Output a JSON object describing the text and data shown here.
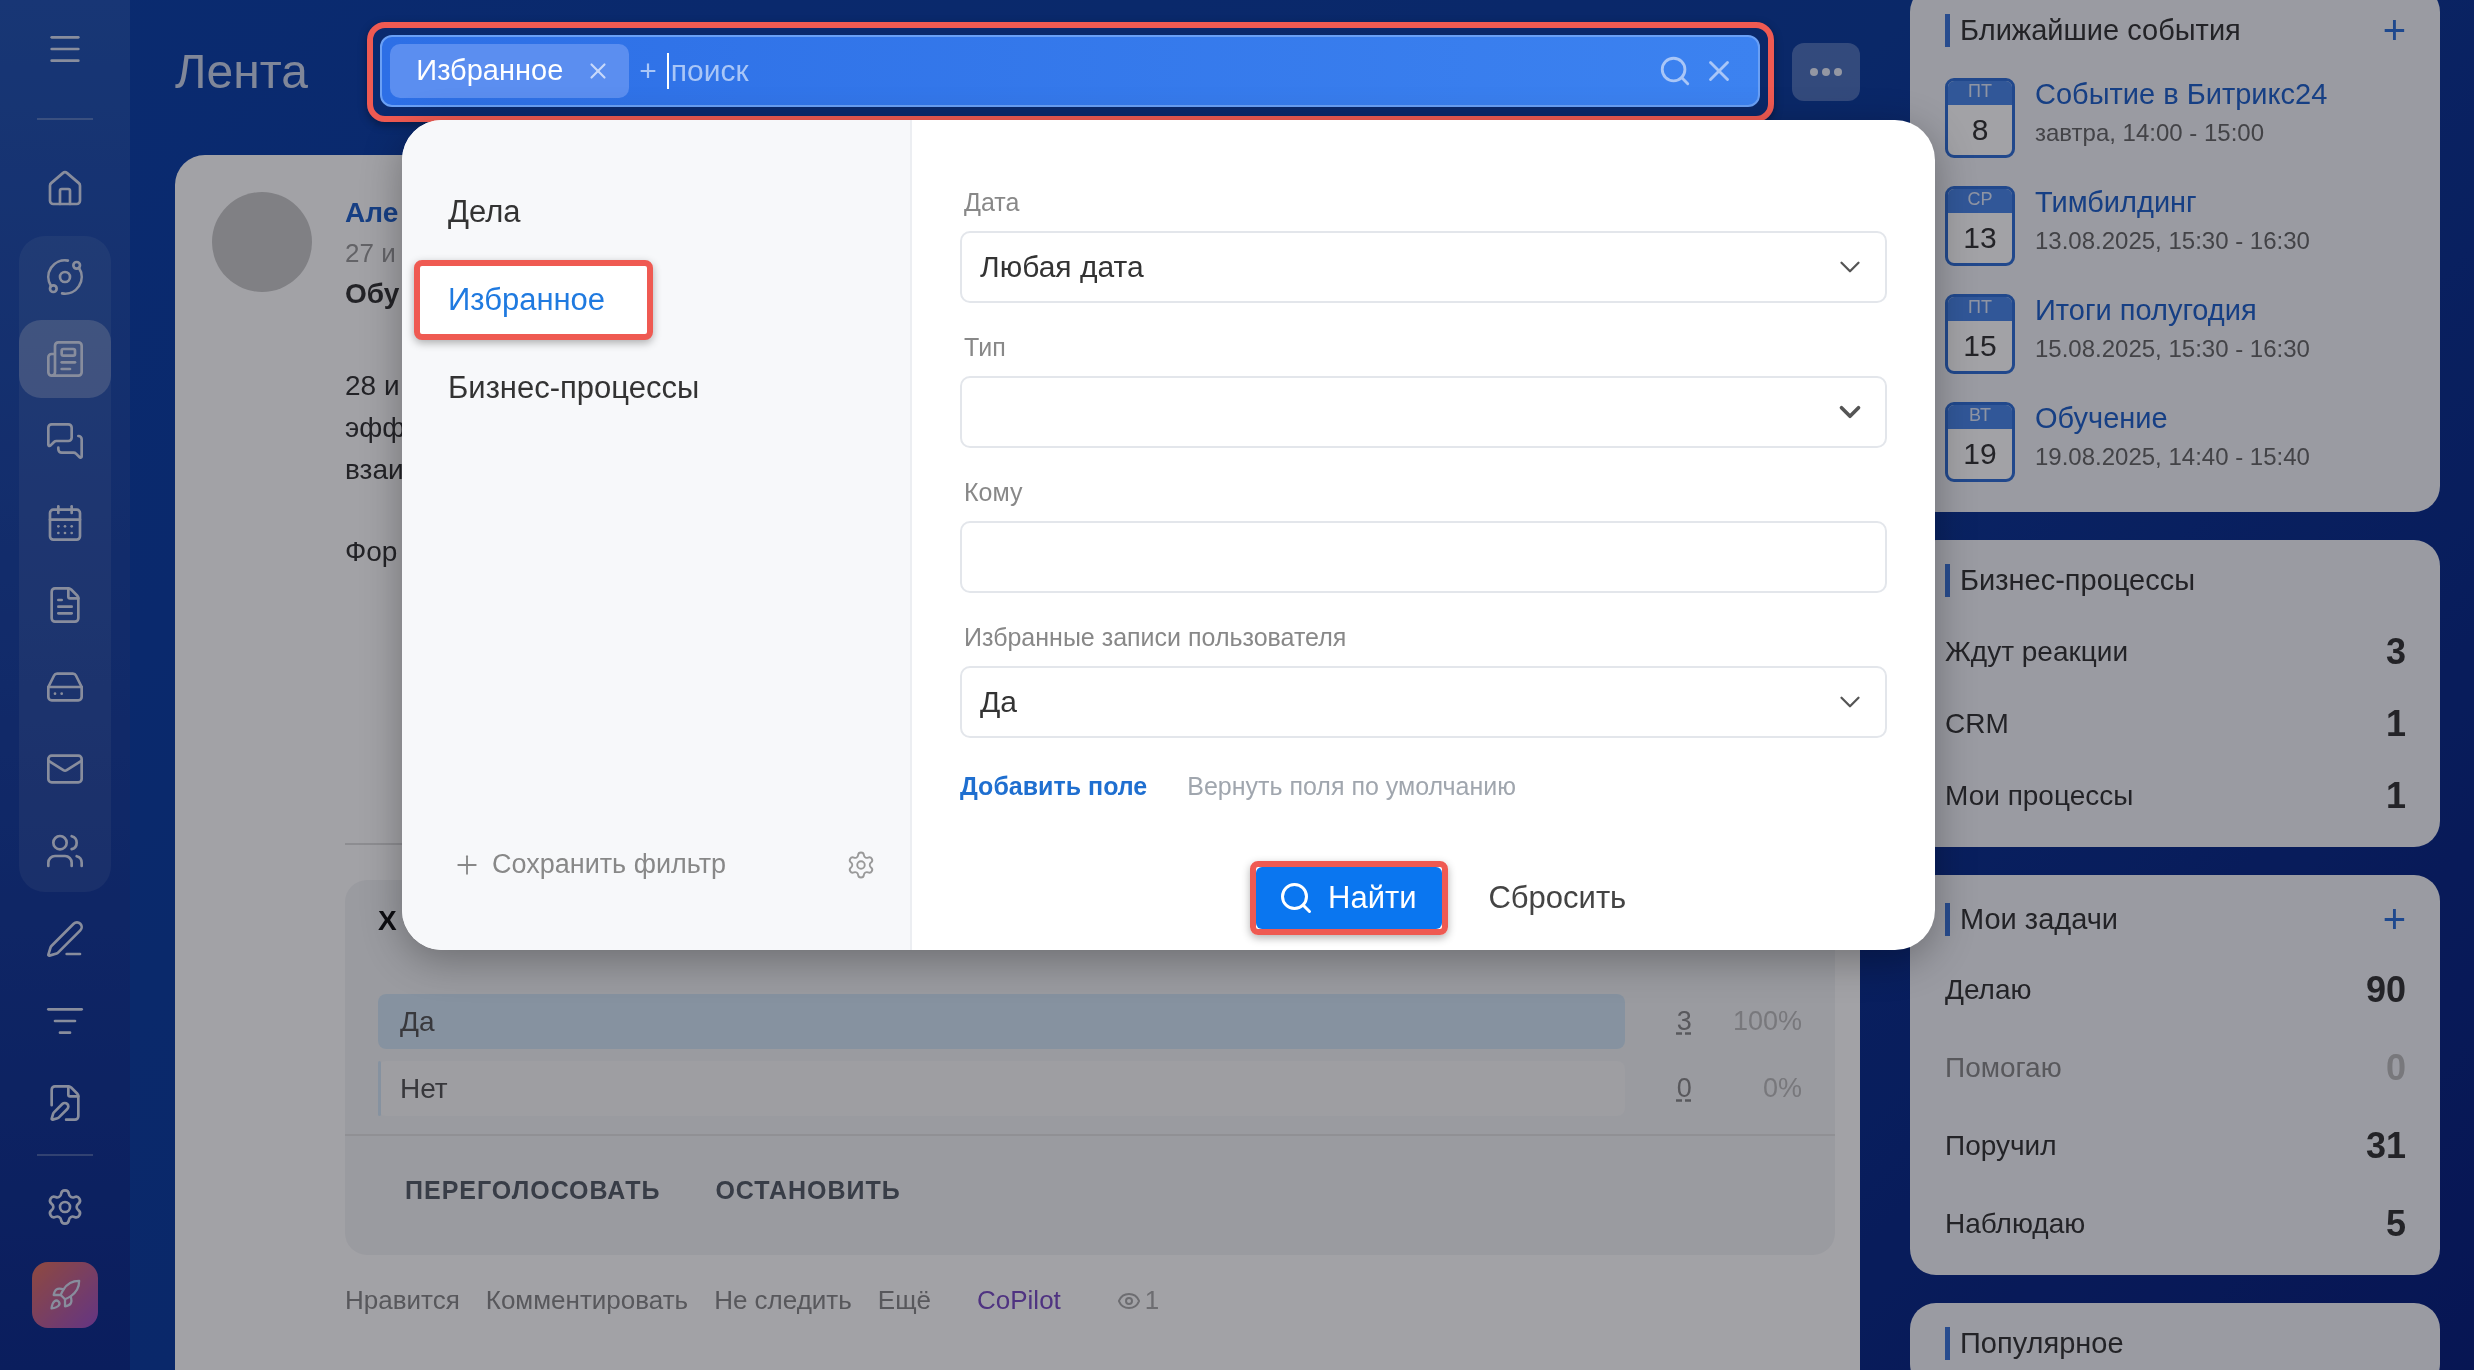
{
  "sidebar": {
    "items": [
      {
        "selected": false
      },
      {
        "selected": false
      },
      {
        "selected": false
      },
      {
        "selected": true
      },
      {
        "selected": false
      },
      {
        "selected": false
      },
      {
        "selected": false
      },
      {
        "selected": false
      },
      {
        "selected": false
      },
      {
        "selected": false
      },
      {
        "selected": false
      },
      {
        "selected": false
      },
      {
        "selected": false
      },
      {
        "selected": false
      }
    ]
  },
  "page_title": "Лента",
  "search": {
    "highlighted": true,
    "tags": [
      {
        "label": "Избранное"
      }
    ],
    "add_sign": "+",
    "placeholder": "поиск"
  },
  "post": {
    "author": "Але",
    "date": "27 и",
    "title": "Обу",
    "body": [
      "28 и",
      "эфф",
      "взаи"
    ],
    "paragraph": "Фор",
    "poll": {
      "title": "Х",
      "options": [
        {
          "label": "Да",
          "count": "3",
          "percent": "100%",
          "level": 1
        },
        {
          "label": "Нет",
          "count": "0",
          "percent": "0%",
          "level": 0
        }
      ],
      "actions": [
        "ПЕРЕГОЛОСОВАТЬ",
        "ОСТАНОВИТЬ"
      ]
    },
    "footer": [
      "Нравится",
      "Комментировать",
      "Не следить",
      "Ещё"
    ],
    "copilot": "CoPilot",
    "views": "1"
  },
  "filter": {
    "presets": [
      {
        "label": "Дела",
        "selected": false,
        "highlighted": false
      },
      {
        "label": "Избранное",
        "selected": true,
        "highlighted": true
      },
      {
        "label": "Бизнес-процессы",
        "selected": false,
        "highlighted": false
      }
    ],
    "save_filter": "Сохранить фильтр",
    "fields": [
      {
        "label": "Дата",
        "kind": "select",
        "value": "Любая дата"
      },
      {
        "label": "Тип",
        "kind": "select"
      },
      {
        "label": "Кому",
        "kind": "text"
      },
      {
        "label": "Избранные записи пользователя",
        "kind": "select",
        "value": "Да"
      }
    ],
    "add_field": "Добавить поле",
    "restore_fields": "Вернуть поля по умолчанию",
    "find": {
      "label": "Найти",
      "highlighted": true
    },
    "reset": "Сбросить"
  },
  "events": {
    "title": "Ближайшие события",
    "add_sign": "+",
    "items": [
      {
        "weekday": "ПТ",
        "day": "8",
        "title": "Событие в Битрикс24",
        "time": "завтра, 14:00 - 15:00"
      },
      {
        "weekday": "СР",
        "day": "13",
        "title": "Тимбилдинг",
        "time": "13.08.2025, 15:30 - 16:30"
      },
      {
        "weekday": "ПТ",
        "day": "15",
        "title": "Итоги полугодия",
        "time": "15.08.2025, 15:30 - 16:30"
      },
      {
        "weekday": "ВТ",
        "day": "19",
        "title": "Обучение",
        "time": "19.08.2025, 14:40 - 15:40"
      }
    ]
  },
  "processes": {
    "title": "Бизнес-процессы",
    "rows": [
      {
        "label": "Ждут реакции",
        "count": "3"
      },
      {
        "label": "CRM",
        "count": "1"
      },
      {
        "label": "Мои процессы",
        "count": "1"
      }
    ]
  },
  "tasks": {
    "title": "Мои задачи",
    "add_sign": "+",
    "rows": [
      {
        "label": "Делаю",
        "count": "90",
        "dimmed": false
      },
      {
        "label": "Помогаю",
        "count": "0",
        "dimmed": true
      },
      {
        "label": "Поручил",
        "count": "31",
        "dimmed": false
      },
      {
        "label": "Наблюдаю",
        "count": "5",
        "dimmed": false
      }
    ]
  },
  "popular": {
    "title": "Популярное"
  }
}
